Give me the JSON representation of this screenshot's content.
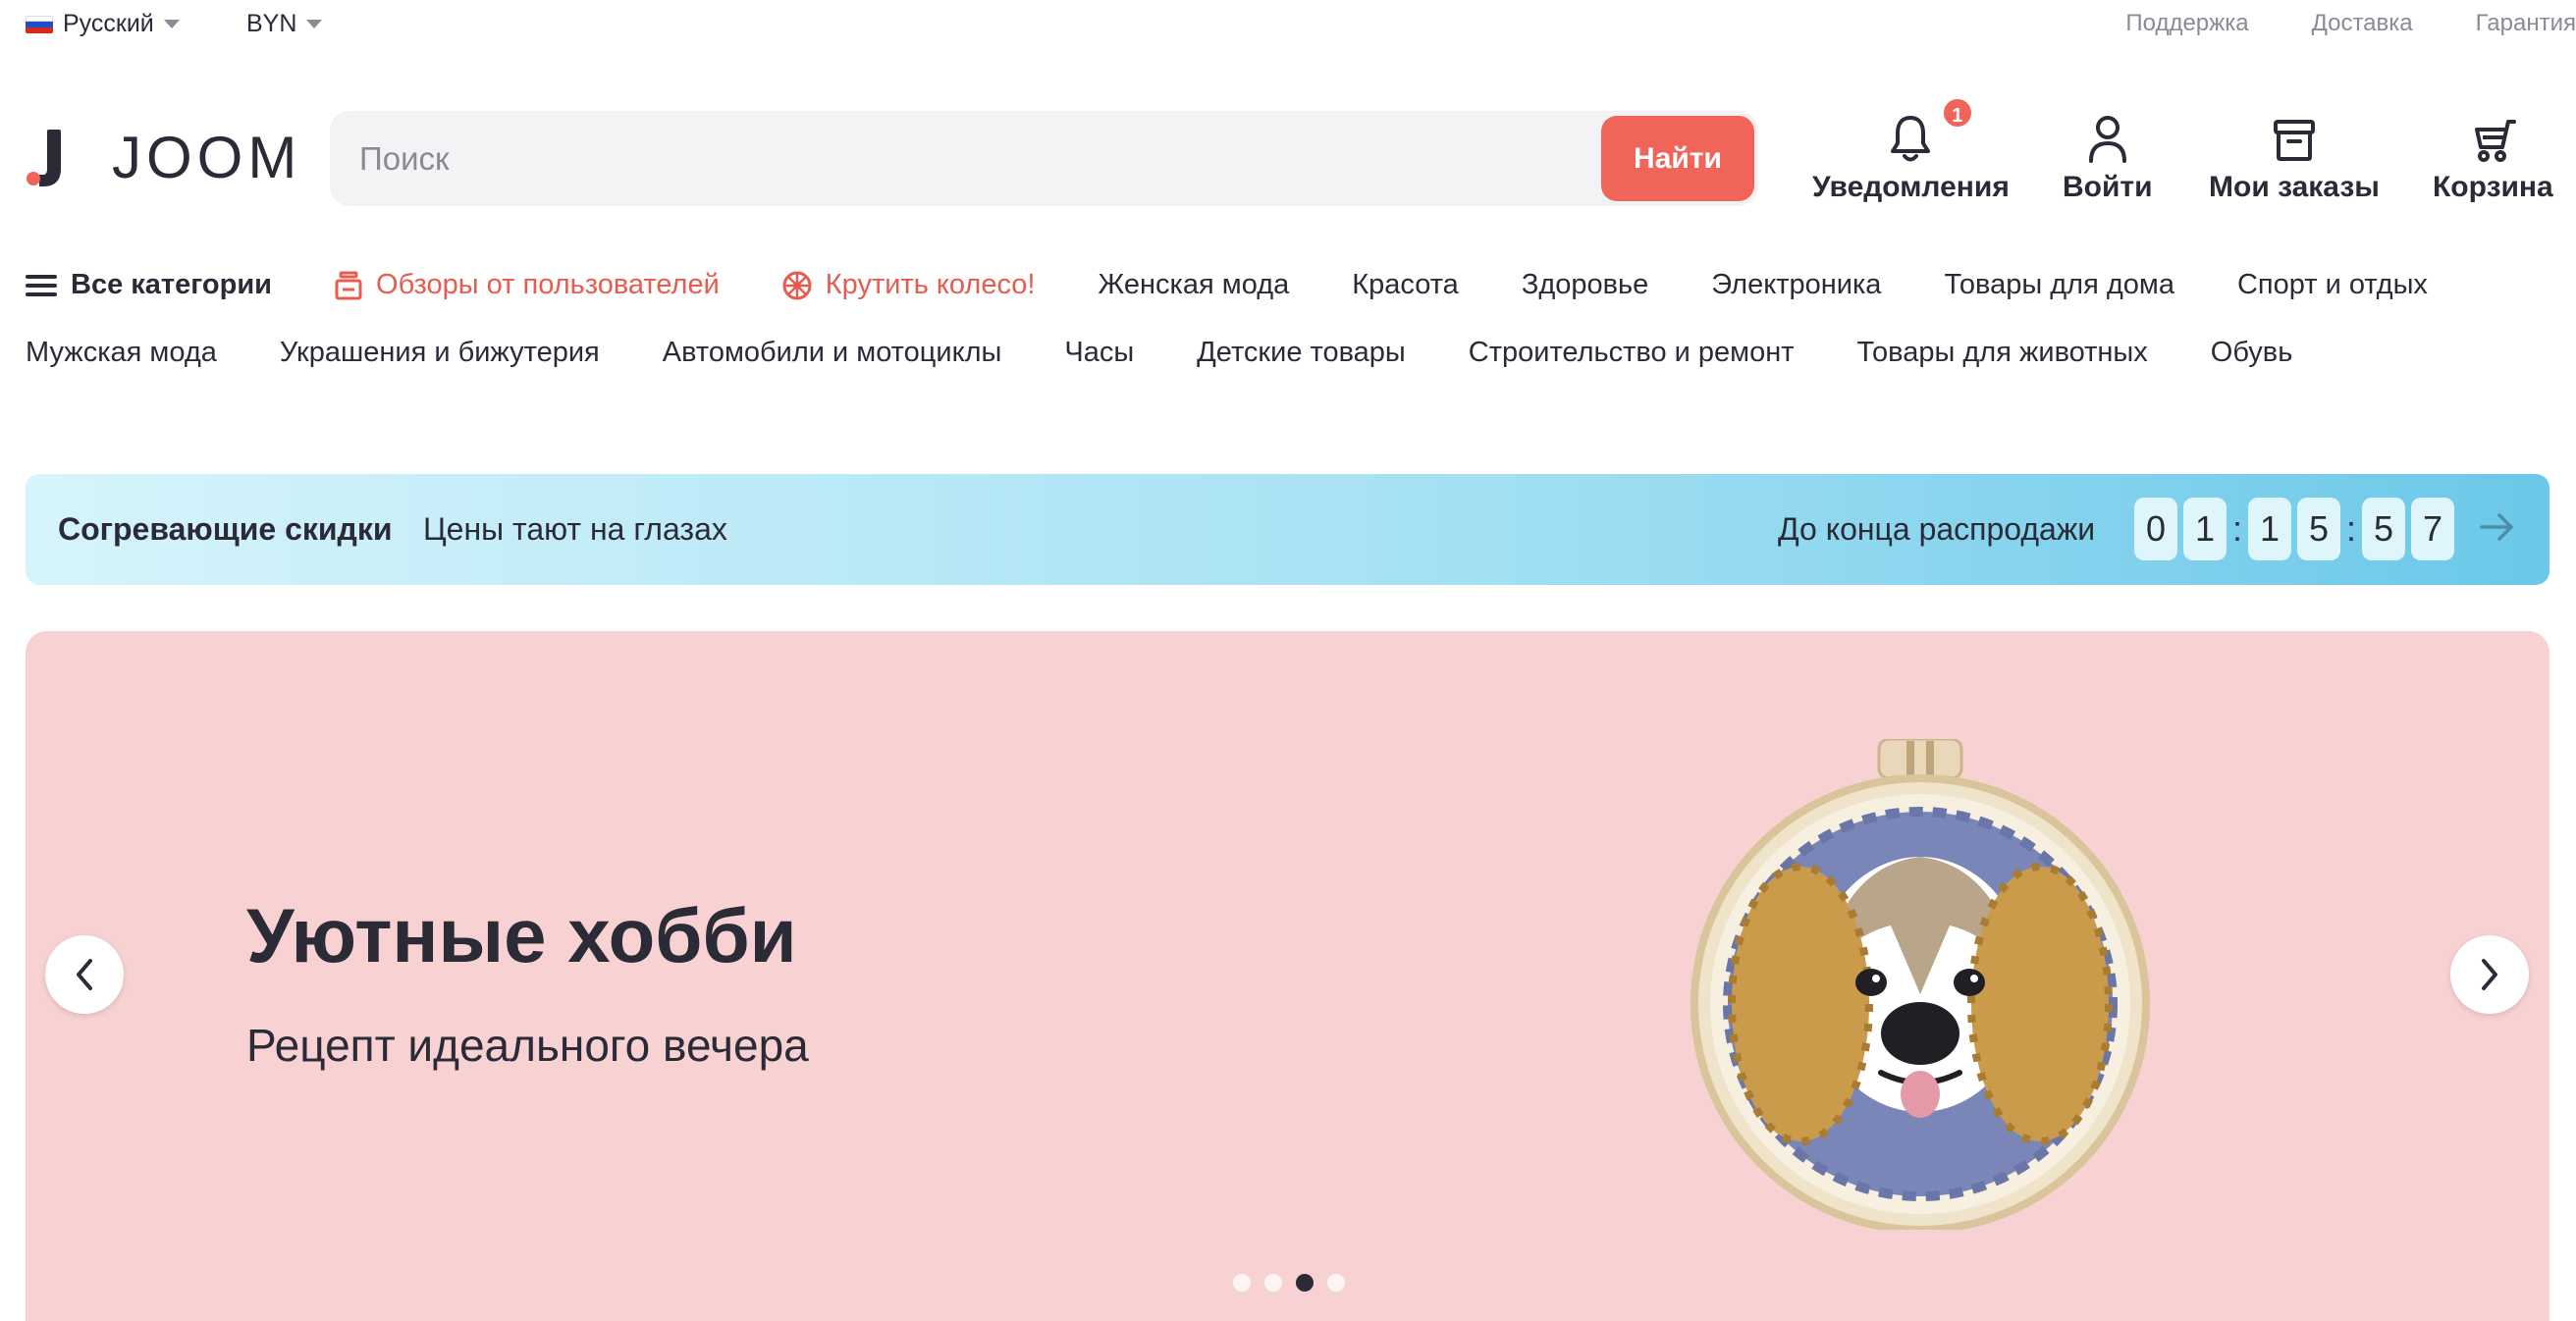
{
  "topbar": {
    "language": "Русский",
    "currency": "BYN",
    "links": [
      "Поддержка",
      "Доставка",
      "Гарантия"
    ]
  },
  "header": {
    "logo_text": "JOOM",
    "search": {
      "placeholder": "Поиск",
      "value": "",
      "button": "Найти"
    },
    "items": [
      {
        "label": "Уведомления",
        "icon": "bell-icon",
        "badge": "1"
      },
      {
        "label": "Войти",
        "icon": "user-icon"
      },
      {
        "label": "Мои заказы",
        "icon": "orders-box-icon"
      },
      {
        "label": "Корзина",
        "icon": "cart-icon"
      }
    ]
  },
  "nav": {
    "row1": [
      "Все категории",
      "Обзоры от пользователей",
      "Крутить колесо!",
      "Женская мода",
      "Красота",
      "Здоровье",
      "Электроника",
      "Товары для дома",
      "Спорт и отдых"
    ],
    "row2": [
      "Мужская мода",
      "Украшения и бижутерия",
      "Автомобили и мотоциклы",
      "Часы",
      "Детские товары",
      "Строительство и ремонт",
      "Товары для животных",
      "Обувь"
    ]
  },
  "promo": {
    "title": "Согревающие скидки",
    "subtitle": "Цены тают на глазах",
    "countdown_label": "До конца распродажи",
    "digits": [
      "0",
      "1",
      "1",
      "5",
      "5",
      "7"
    ],
    "separator": ":"
  },
  "hero": {
    "title": "Уютные хобби",
    "subtitle": "Рецепт идеального вечера",
    "slide_count": 4,
    "active_slide": 3,
    "background": "#f8d1d2"
  },
  "colors": {
    "accent": "#f0645a",
    "text": "#2b2b38",
    "muted": "#8a8a96"
  }
}
